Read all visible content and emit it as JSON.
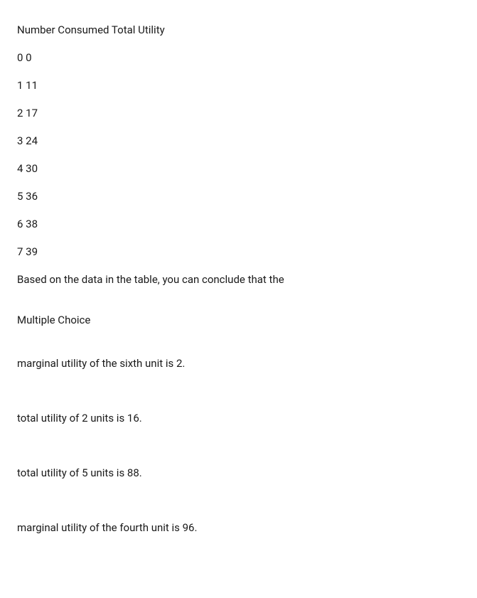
{
  "chart_data": {
    "type": "table",
    "columns": [
      "Number Consumed",
      "Total Utility"
    ],
    "rows": [
      {
        "number_consumed": 0,
        "total_utility": 0
      },
      {
        "number_consumed": 1,
        "total_utility": 11
      },
      {
        "number_consumed": 2,
        "total_utility": 17
      },
      {
        "number_consumed": 3,
        "total_utility": 24
      },
      {
        "number_consumed": 4,
        "total_utility": 30
      },
      {
        "number_consumed": 5,
        "total_utility": 36
      },
      {
        "number_consumed": 6,
        "total_utility": 38
      },
      {
        "number_consumed": 7,
        "total_utility": 39
      }
    ]
  },
  "table": {
    "header": "Number Consumed Total Utility",
    "rows": [
      "0 0",
      "1 11",
      "2 17",
      "3 24",
      "4 30",
      "5 36",
      "6 38",
      "7 39"
    ]
  },
  "question": "Based on the data in the table, you can conclude that the",
  "section_label": "Multiple Choice",
  "options": [
    "marginal utility of the sixth unit is 2.",
    "total utility of 2 units is 16.",
    "total utility of 5 units is 88.",
    "marginal utility of the fourth unit is 96."
  ]
}
